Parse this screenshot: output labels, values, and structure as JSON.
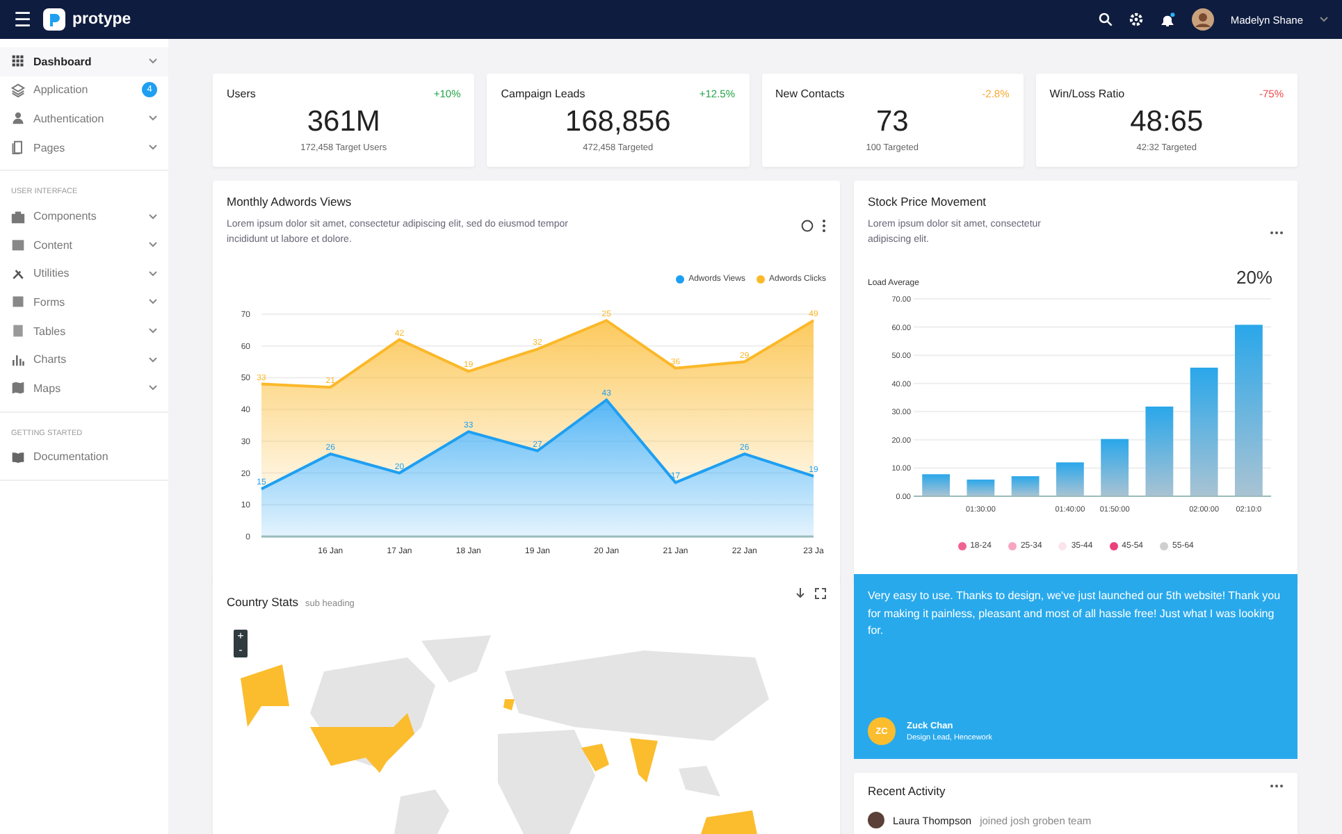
{
  "header": {
    "menu_icon": "☰",
    "brand": "protype",
    "notification_dot": true,
    "user": {
      "name": "Madelyn Shane"
    }
  },
  "sidebar": {
    "sections": [
      {
        "items": [
          {
            "label": "Dashboard",
            "selected": true,
            "chevron": true
          },
          {
            "label": "Application",
            "selected": false,
            "chevron": false,
            "badge": "4"
          },
          {
            "label": "Authentication",
            "selected": false,
            "chevron": true
          },
          {
            "label": "Pages",
            "selected": false,
            "chevron": true
          }
        ]
      },
      {
        "heading": "USER INTERFACE",
        "items": [
          {
            "label": "Components",
            "selected": false,
            "chevron": true
          },
          {
            "label": "Content",
            "selected": false,
            "chevron": true
          },
          {
            "label": "Utilities",
            "selected": false,
            "chevron": true
          },
          {
            "label": "Forms",
            "selected": false,
            "chevron": true
          },
          {
            "label": "Tables",
            "selected": false,
            "chevron": true
          },
          {
            "label": "Charts",
            "selected": false,
            "chevron": true
          },
          {
            "label": "Maps",
            "selected": false,
            "chevron": true
          }
        ]
      },
      {
        "heading": "GETTING STARTED",
        "items": [
          {
            "label": "Documentation",
            "selected": false,
            "chevron": false
          }
        ]
      }
    ]
  },
  "stats": [
    {
      "title": "Users",
      "change": "+10%",
      "color": "#22a447",
      "value": "361M",
      "caption": "172,458 Target Users"
    },
    {
      "title": "Campaign Leads",
      "change": "+12.5%",
      "color": "#22a447",
      "value": "168,856",
      "caption": "472,458 Targeted"
    },
    {
      "title": "New Contacts",
      "change": "-2.8%",
      "color": "#f7a935",
      "value": "73",
      "caption": "100 Targeted"
    },
    {
      "title": "Win/Loss Ratio",
      "change": "-75%",
      "color": "#f04a4a",
      "value": "48:65",
      "caption": "42:32 Targeted"
    }
  ],
  "adwords": {
    "title": "Monthly Adwords Views",
    "description": "Lorem ipsum dolor sit amet, consectetur adipiscing elit, sed do eiusmod tempor incididunt ut labore et dolore.",
    "chart_data": {
      "type": "area",
      "grid": true,
      "stacked": true,
      "data_labels": true,
      "categories": [
        null,
        "16 Jan",
        "17 Jan",
        "18 Jan",
        "19 Jan",
        "20 Jan",
        "21 Jan",
        "22 Jan",
        "23 Ja"
      ],
      "ylim": [
        0,
        70
      ],
      "yticks": [
        0,
        10,
        20,
        30,
        40,
        50,
        60,
        70
      ],
      "series": [
        {
          "name": "Adwords Views",
          "color": "#1e9ff2",
          "values": [
            15,
            26,
            20,
            33,
            27,
            43,
            17,
            26,
            19
          ]
        },
        {
          "name": "Adwords Clicks",
          "color": "#fbb829",
          "values": [
            33,
            21,
            42,
            19,
            32,
            25,
            36,
            29,
            49
          ]
        }
      ]
    }
  },
  "stock": {
    "title": "Stock Price Movement",
    "description": "Lorem ipsum dolor sit amet, consectetur adipiscing elit.",
    "metric_label": "Load Average",
    "metric_value": "20%",
    "chart_data": {
      "type": "bar",
      "grid": true,
      "categories": [
        null,
        "01:30:00",
        null,
        "01:40:00",
        "01:50:00",
        null,
        "02:00:00",
        "02:10:0"
      ],
      "ylim": [
        0,
        70
      ],
      "yticks": [
        {
          "value": 0,
          "label": "0.00"
        },
        {
          "value": 10,
          "label": "10.00"
        },
        {
          "value": 20,
          "label": "20.00"
        },
        {
          "value": 30,
          "label": "30.00"
        },
        {
          "value": 40,
          "label": "40.00"
        },
        {
          "value": 50,
          "label": "50.00"
        },
        {
          "value": 60,
          "label": "60.00"
        },
        {
          "value": 70,
          "label": "70.00"
        }
      ],
      "series": [
        {
          "color": "#2aa7ea",
          "values": [
            7.8,
            5.9,
            7.1,
            12,
            20.3,
            31.8,
            45.6,
            60.8
          ]
        }
      ]
    },
    "legend": [
      {
        "label": "18-24",
        "color": "#f06292"
      },
      {
        "label": "25-34",
        "color": "#f8a5c2"
      },
      {
        "label": "35-44",
        "color": "#fce4ec"
      },
      {
        "label": "45-54",
        "color": "#ec407a"
      },
      {
        "label": "55-64",
        "color": "#cfcfcf"
      }
    ]
  },
  "country_stats": {
    "title": "Country Stats",
    "subheading": "sub heading",
    "zoom_in": "+",
    "zoom_out": "-"
  },
  "testimonial": {
    "quote": "Very easy to use. Thanks to design, we've just launched our 5th website! Thank you for making it painless, pleasant and most of all hassle free! Just what I was looking for.",
    "initials": "ZC",
    "name": "Zuck Chan",
    "role": "Design Lead, Hencework"
  },
  "recent_activity": {
    "title": "Recent Activity",
    "items": [
      {
        "name": "Laura Thompson",
        "action": "joined josh groben team"
      }
    ]
  }
}
